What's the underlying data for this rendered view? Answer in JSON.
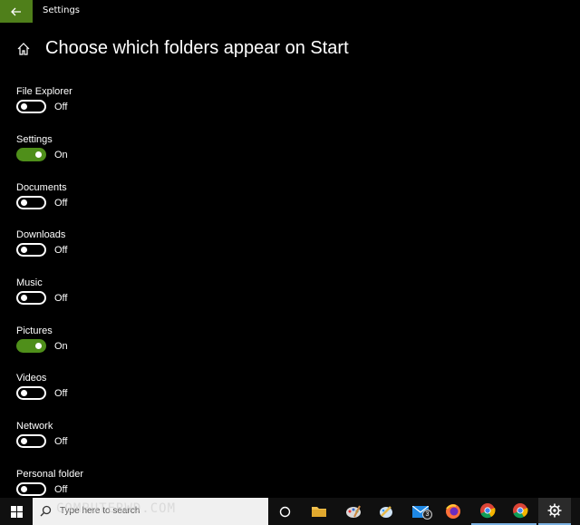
{
  "window": {
    "title": "Settings"
  },
  "page": {
    "title": "Choose which folders appear on Start"
  },
  "settings": [
    {
      "label": "File Explorer",
      "state": "Off",
      "on": false
    },
    {
      "label": "Settings",
      "state": "On",
      "on": true
    },
    {
      "label": "Documents",
      "state": "Off",
      "on": false
    },
    {
      "label": "Downloads",
      "state": "Off",
      "on": false
    },
    {
      "label": "Music",
      "state": "Off",
      "on": false
    },
    {
      "label": "Pictures",
      "state": "On",
      "on": true
    },
    {
      "label": "Videos",
      "state": "Off",
      "on": false
    },
    {
      "label": "Network",
      "state": "Off",
      "on": false
    },
    {
      "label": "Personal folder",
      "state": "Off",
      "on": false
    }
  ],
  "taskbar": {
    "search_placeholder": "Type here to search",
    "watermark": "COMPUTERWD.COM",
    "mail_badge": "3",
    "icons": [
      "windows-start-icon",
      "task-view-icon",
      "file-explorer-icon",
      "paint-icon",
      "paint-3d-icon",
      "mail-icon",
      "firefox-icon",
      "chrome-icon",
      "chrome-profile-icon",
      "settings-gear-icon"
    ]
  },
  "colors": {
    "accent": "#4f8f1a",
    "background": "#000000",
    "back_button": "#4f7f1a"
  }
}
